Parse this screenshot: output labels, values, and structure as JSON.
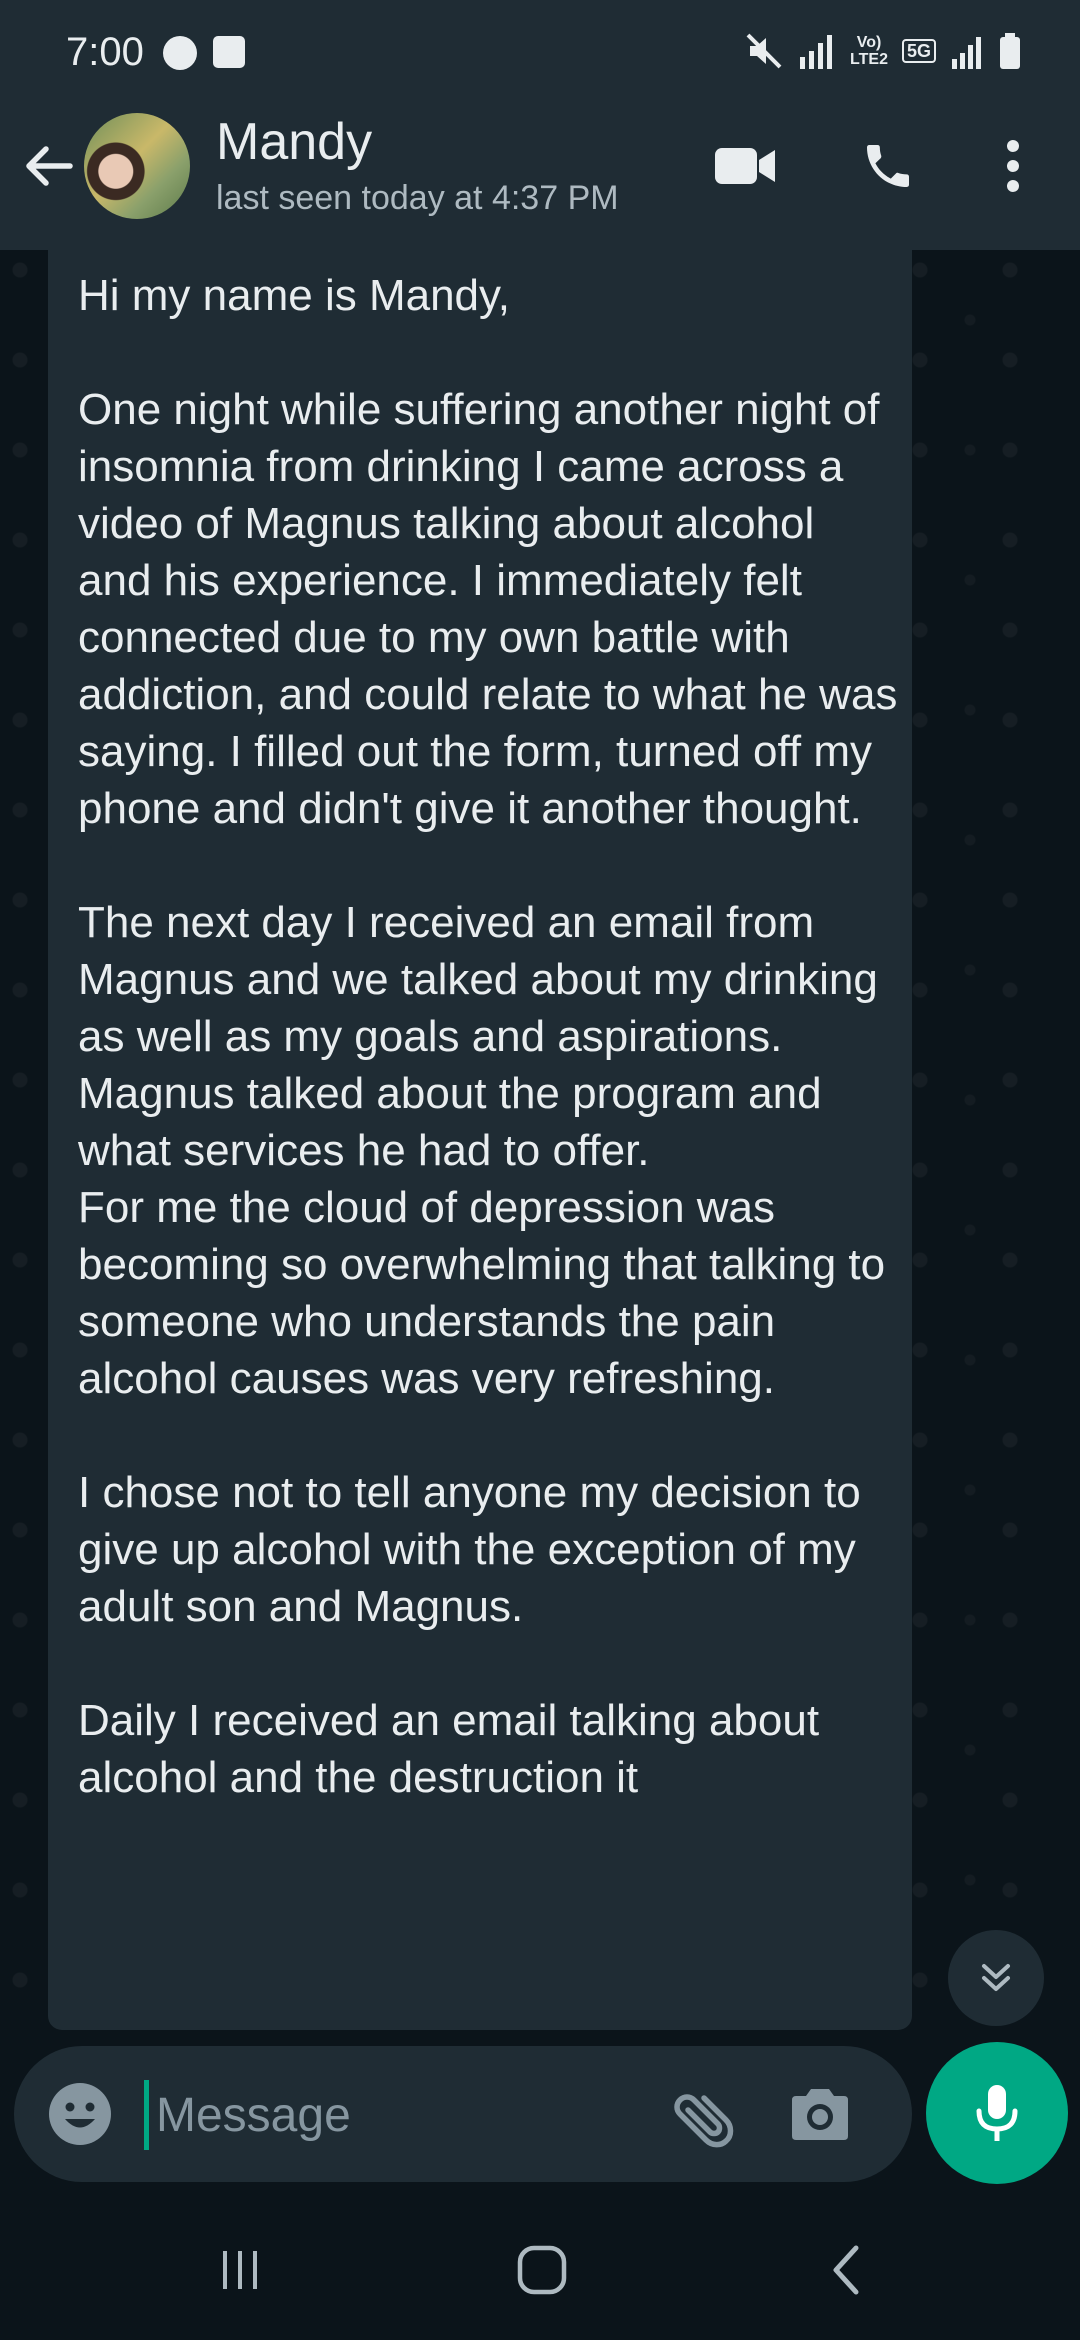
{
  "status_bar": {
    "time": "7:00",
    "network_top": "Vo)",
    "network_bottom": "LTE2",
    "badge": "5G"
  },
  "header": {
    "contact_name": "Mandy",
    "last_seen": "last seen today at 4:37 PM"
  },
  "message": {
    "text": "Hi my name is Mandy,\n\nOne night while suffering another night of insomnia from drinking I came across a video of Magnus talking about alcohol and his experience. I immediately felt connected due to my own battle with addiction, and could relate to what he was saying. I filled out the form, turned off my phone and didn't give it another thought.\n\nThe next day I received an email from Magnus and we talked about my drinking as well as my goals and aspirations. Magnus talked about the program and what services he had to offer.\nFor me the cloud of depression was becoming so overwhelming that talking to someone who understands the pain alcohol causes was very refreshing.\n\nI chose not to tell anyone my decision to give up alcohol with the exception of my adult son and Magnus.\n\nDaily I received an email talking about alcohol and the destruction it"
  },
  "composer": {
    "placeholder": "Message"
  },
  "colors": {
    "header_bg": "#1f2c34",
    "chat_bg": "#0b141a",
    "bubble_bg": "#1f2c34",
    "accent": "#00a884",
    "text_primary": "#e9edef",
    "text_secondary": "#8696a0"
  }
}
